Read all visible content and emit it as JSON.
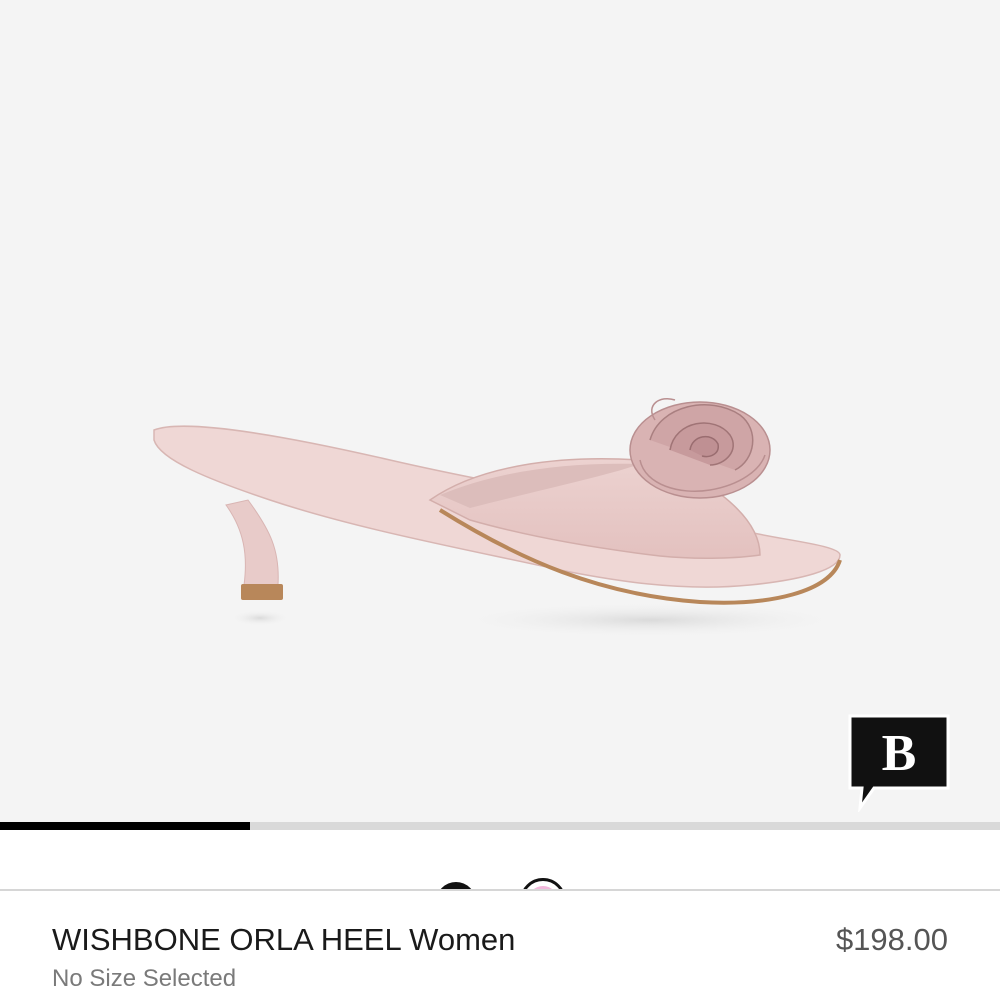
{
  "product": {
    "name": "WISHBONE ORLA HEEL Women",
    "price": "$198.00",
    "size_status": "No Size Selected",
    "image_icon": "shoe-image"
  },
  "gallery": {
    "progress": 0.25,
    "progress_color": "#000000",
    "track_color": "#d9d9d9",
    "background": "#f4f4f4"
  },
  "badge": {
    "icon": "brand-b-chat-icon",
    "letter": "B"
  },
  "swatches": [
    {
      "name": "black",
      "color": "#111111",
      "selected": false
    },
    {
      "name": "pink",
      "color": "#f2b8dc",
      "selected": true
    }
  ]
}
